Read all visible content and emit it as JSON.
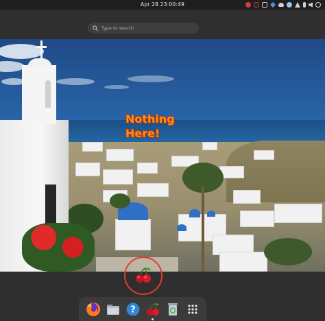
{
  "topbar": {
    "clock": "Apr 28  23:00:49",
    "tray_icons": [
      {
        "name": "record-icon",
        "color": "#d63b3b"
      },
      {
        "name": "cherry-tray-icon",
        "color": "#c23030"
      },
      {
        "name": "screen-icon",
        "color": "#d0d0d0"
      },
      {
        "name": "dropbox-icon",
        "color": "#4a90e2"
      },
      {
        "name": "cloud-icon",
        "color": "#d0d0d0"
      },
      {
        "name": "chat-icon",
        "color": "#9cc4e6"
      },
      {
        "name": "network-icon",
        "color": "#d0d0d0"
      },
      {
        "name": "bluetooth-icon",
        "color": "#d0d0d0"
      },
      {
        "name": "volume-icon",
        "color": "#d0d0d0"
      },
      {
        "name": "power-icon",
        "color": "#d0d0d0"
      }
    ]
  },
  "search": {
    "placeholder": "Type to search",
    "icon": "search-icon"
  },
  "workspace": {
    "message": "Nothing\nHere!"
  },
  "dock": {
    "items": [
      {
        "name": "firefox",
        "icon": "firefox-icon",
        "running": false
      },
      {
        "name": "files",
        "icon": "folder-icon",
        "running": false
      },
      {
        "name": "help",
        "icon": "help-icon",
        "running": false
      },
      {
        "name": "cherry-app",
        "icon": "cherry-icon",
        "running": true
      },
      {
        "name": "trash",
        "icon": "trash-icon",
        "running": false
      },
      {
        "name": "app-grid",
        "icon": "app-grid-icon",
        "running": false
      }
    ]
  },
  "colors": {
    "accent": "#e53a2e",
    "overlay_text": "#ff8a1a",
    "panel": "#1e1e1e",
    "overview_bg": "#2f2f2f"
  }
}
